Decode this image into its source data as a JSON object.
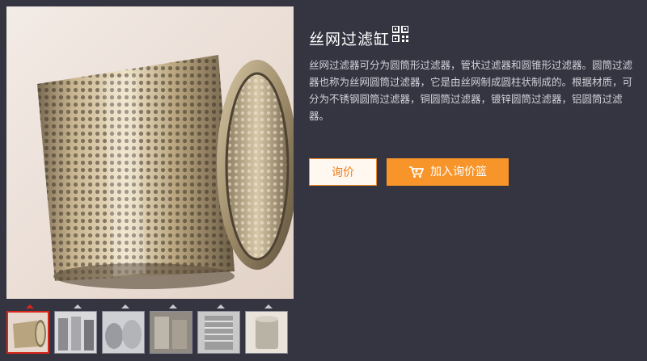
{
  "product": {
    "title": "丝网过滤缸",
    "description": "丝网过滤器可分为圆筒形过滤器，管状过滤器和圆锥形过滤器。圆筒过滤器也称为丝网圆筒过滤器，它是由丝网制成圆柱状制成的。根据材质，可分为不锈钢圆筒过滤器，铜圆筒过滤器，镀锌圆筒过滤器，铝圆筒过滤器。",
    "qr_icon": "qr-code-icon",
    "image_subject": "perforated-metal-cylinder-filter"
  },
  "actions": {
    "inquiry_label": "询价",
    "add_to_basket_label": "加入询价篮",
    "cart_icon": "cart-icon"
  },
  "thumbnails": {
    "count": 6,
    "active_index": 0
  },
  "colors": {
    "background": "#353542",
    "accent_orange": "#f7952b",
    "active_thumb_border": "#d9261c"
  }
}
